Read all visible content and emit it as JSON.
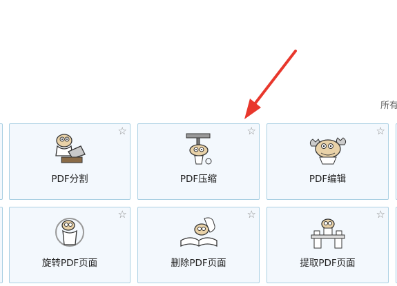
{
  "corner_text": "所有",
  "tools": [
    {
      "label": "PDF分割",
      "icon": "axe-mascot-icon"
    },
    {
      "label": "PDF压缩",
      "icon": "clamp-mascot-icon"
    },
    {
      "label": "PDF编辑",
      "icon": "wrench-mascot-icon"
    },
    {
      "label": "旋转PDF页面",
      "icon": "rotate-mascot-icon"
    },
    {
      "label": "删除PDF页面",
      "icon": "book-mascot-icon"
    },
    {
      "label": "提取PDF页面",
      "icon": "desk-mascot-icon"
    }
  ],
  "star_glyph": "☆",
  "colors": {
    "card_border": "#a9cfe3",
    "card_bg": "#f3f8fd",
    "arrow": "#e8372c"
  }
}
